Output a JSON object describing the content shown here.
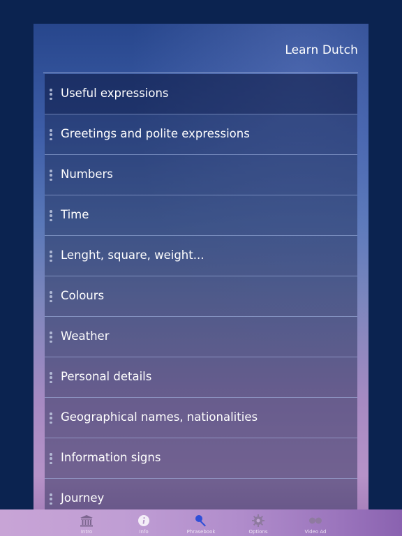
{
  "header": {
    "title": "Learn Dutch"
  },
  "list": {
    "items": [
      {
        "label": "Useful expressions"
      },
      {
        "label": "Greetings and polite expressions"
      },
      {
        "label": "Numbers"
      },
      {
        "label": "Time"
      },
      {
        "label": "Lenght, square, weight..."
      },
      {
        "label": "Colours"
      },
      {
        "label": "Weather"
      },
      {
        "label": "Personal details"
      },
      {
        "label": "Geographical names, nationalities"
      },
      {
        "label": "Information signs"
      },
      {
        "label": "Journey"
      }
    ]
  },
  "tabbar": {
    "tabs": [
      {
        "label": "Intro",
        "icon": "building-icon"
      },
      {
        "label": "Info",
        "icon": "info-icon"
      },
      {
        "label": "Phrasebook",
        "icon": "microphone-icon",
        "active": true
      },
      {
        "label": "Options",
        "icon": "gear-icon"
      },
      {
        "label": "Video Ad",
        "icon": "video-ad-icon"
      }
    ]
  },
  "colors": {
    "background": "#0b2350",
    "active_tab_icon": "#2f4fd8"
  }
}
